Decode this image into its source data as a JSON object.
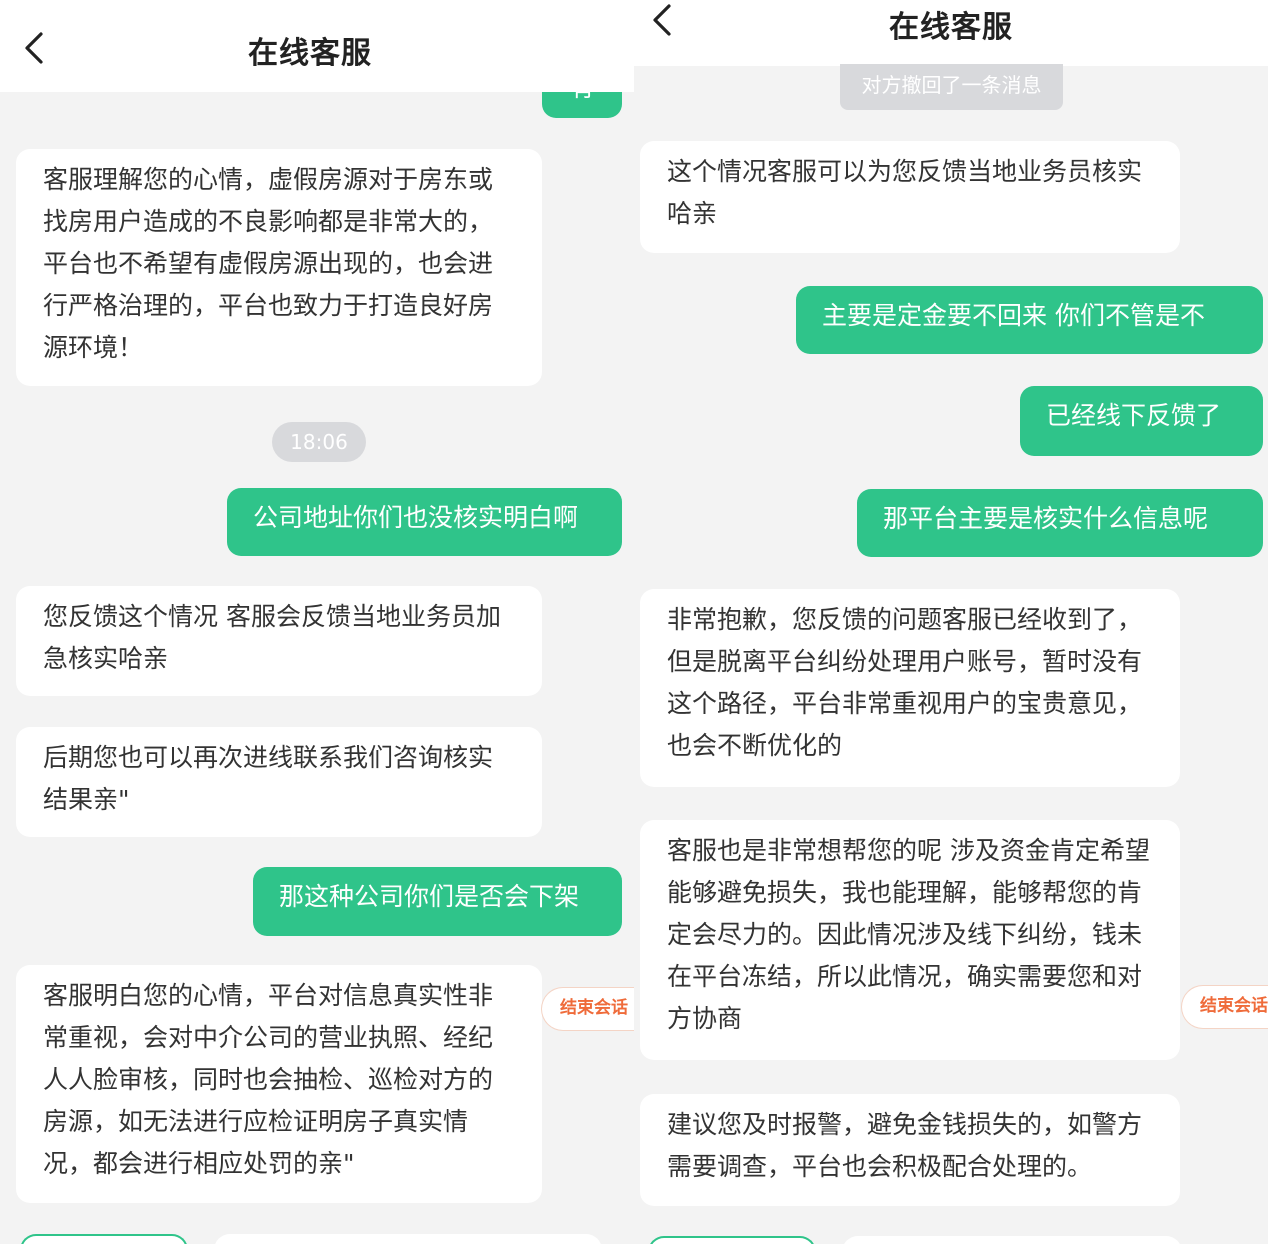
{
  "left": {
    "header": {
      "title": "在线客服"
    },
    "partial_user_text": "有",
    "messages": [
      {
        "role": "agent",
        "text": "客服理解您的心情，虚假房源对于房东或找房用户造成的不良影响都是非常大的，平台也不希望有虚假房源出现的，也会进行严格治理的，平台也致力于打造良好房源环境！"
      },
      {
        "role": "time",
        "text": "18:06"
      },
      {
        "role": "user",
        "text": "公司地址你们也没核实明白啊"
      },
      {
        "role": "agent",
        "text": "您反馈这个情况  客服会反馈当地业务员加急核实哈亲"
      },
      {
        "role": "agent",
        "text": "后期您也可以再次进线联系我们咨询核实结果亲\""
      },
      {
        "role": "user",
        "text": "那这种公司你们是否会下架"
      },
      {
        "role": "agent",
        "text": "客服明白您的心情，平台对信息真实性非常重视，会对中介公司的营业执照、经纪人人脸审核，同时也会抽检、巡检对方的房源，如无法进行应检证明房子真实情况，都会进行相应处罚的亲\""
      }
    ],
    "end_session_label": "结束会话"
  },
  "right": {
    "header": {
      "title": "在线客服"
    },
    "recall_notice": "对方撤回了一条消息",
    "messages": [
      {
        "role": "agent",
        "text": "这个情况客服可以为您反馈当地业务员核实哈亲"
      },
      {
        "role": "user",
        "text": "主要是定金要不回来 你们不管是不"
      },
      {
        "role": "user",
        "text": "已经线下反馈了"
      },
      {
        "role": "user",
        "text": "那平台主要是核实什么信息呢"
      },
      {
        "role": "agent",
        "text": "非常抱歉，您反馈的问题客服已经收到了，但是脱离平台纠纷处理用户账号，暂时没有这个路径，平台非常重视用户的宝贵意见，也会不断优化的"
      },
      {
        "role": "agent",
        "text": "客服也是非常想帮您的呢  涉及资金肯定希望能够避免损失，我也能理解，能够帮您的肯定会尽力的。因此情况涉及线下纠纷，钱未在平台冻结，所以此情况，确实需要您和对方协商"
      },
      {
        "role": "agent",
        "text": "建议您及时报警，避免金钱损失的，如警方需要调查，平台也会积极配合处理的。"
      }
    ],
    "end_session_label": "结束会话"
  },
  "colors": {
    "accent_green": "#2fc48a",
    "end_orange": "#ef6b3a",
    "badge_gray": "#d8d9dc"
  },
  "icons": {
    "back": "chevron-left-icon"
  }
}
